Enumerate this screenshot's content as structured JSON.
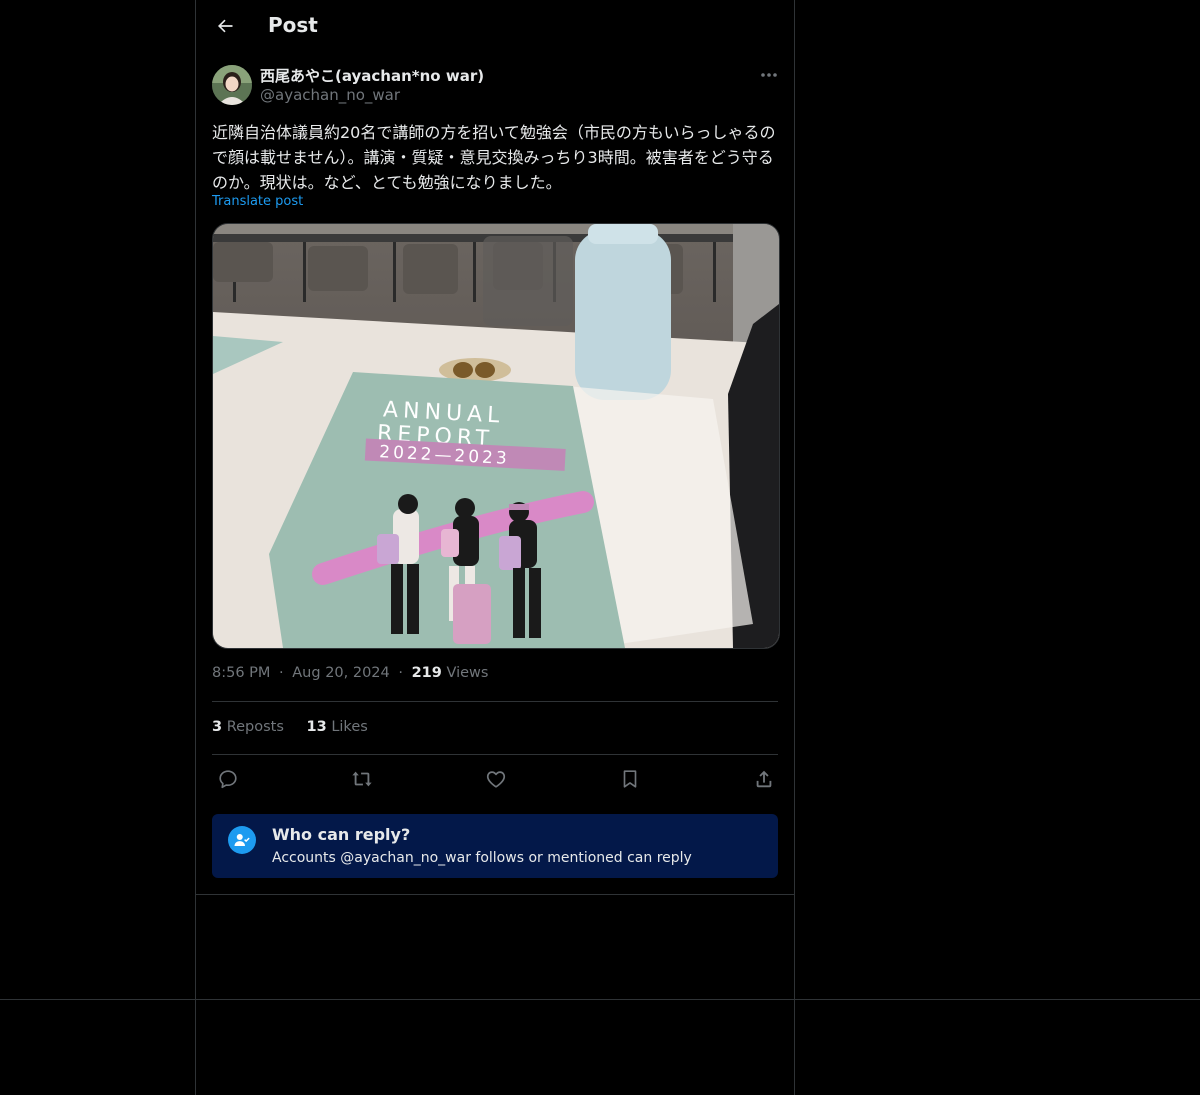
{
  "header": {
    "title": "Post",
    "back_icon": "arrow-left-icon"
  },
  "author": {
    "display_name": "西尾あやこ(ayachan*no war)",
    "handle": "@ayachan_no_war",
    "more_icon": "more-horizontal-icon"
  },
  "post": {
    "text": "近隣自治体議員約20名で講師の方を招いて勉強会（市民の方もいらっしゃるので顔は載せません）。講演・質疑・意見交換みっちり3時間。被害者をどう守るのか。現状は。など、とても勉強になりました。",
    "translate_label": "Translate post",
    "image": {
      "report_title_1": "ANNUAL",
      "report_title_2": "REPORT",
      "report_years": "2022—2023"
    }
  },
  "meta": {
    "time": "8:56 PM",
    "sep1": "·",
    "date": "Aug 20, 2024",
    "sep2": "·",
    "views_count": "219",
    "views_label": "Views"
  },
  "stats": {
    "reposts_count": "3",
    "reposts_label": "Reposts",
    "likes_count": "13",
    "likes_label": "Likes"
  },
  "actions": [
    "reply-icon",
    "repost-icon",
    "like-icon",
    "bookmark-icon",
    "share-icon"
  ],
  "who_can_reply": {
    "title": "Who can reply?",
    "description": "Accounts @ayachan_no_war follows or mentioned can reply"
  },
  "colors": {
    "background": "#000000",
    "accent": "#1d9bf0",
    "reply_box": "#031849",
    "border": "#2f3336"
  }
}
